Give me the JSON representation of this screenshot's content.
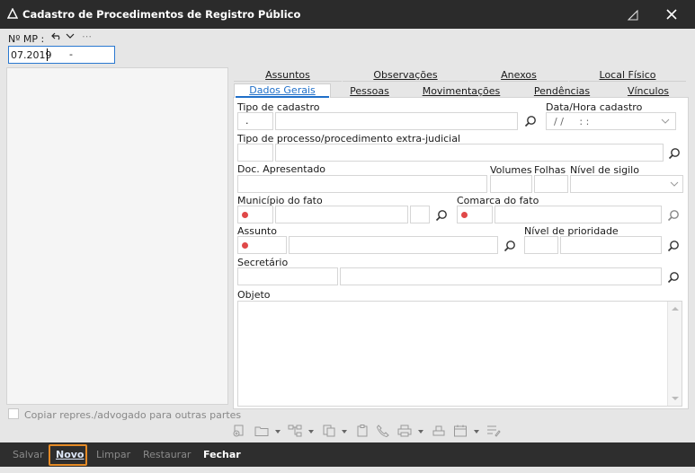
{
  "window": {
    "title": "Cadastro de Procedimentos de Registro Público"
  },
  "mp": {
    "label": "Nº MP :",
    "value": "07.2019",
    "suffix": "-"
  },
  "tabs_top": [
    "Assuntos",
    "Observações",
    "Anexos",
    "Local Físico"
  ],
  "tabs_bottom": [
    "Dados Gerais",
    "Pessoas",
    "Movimentações",
    "Pendências",
    "Vínculos"
  ],
  "form": {
    "tipo_cadastro": {
      "label": "Tipo de cadastro",
      "value": "."
    },
    "data_hora": {
      "label": "Data/Hora cadastro",
      "value": "/ /     : :"
    },
    "tipo_processo": {
      "label": "Tipo de processo/procedimento extra-judicial"
    },
    "doc_apresentado": {
      "label": "Doc. Apresentado"
    },
    "volumes": {
      "label": "Volumes"
    },
    "folhas": {
      "label": "Folhas"
    },
    "nivel_sigilo": {
      "label": "Nível de sigilo"
    },
    "municipio": {
      "label": "Município do fato"
    },
    "comarca": {
      "label": "Comarca do fato"
    },
    "assunto": {
      "label": "Assunto"
    },
    "nivel_prioridade": {
      "label": "Nível de prioridade"
    },
    "secretario": {
      "label": "Secretário"
    },
    "objeto": {
      "label": "Objeto"
    }
  },
  "copiar": {
    "label": "Copiar repres./advogado para outras partes",
    "checked": false
  },
  "bottom_buttons": {
    "salvar": "Salvar",
    "novo": "Novo",
    "limpar": "Limpar",
    "restaurar": "Restaurar",
    "fechar": "Fechar"
  },
  "colors": {
    "titlebar": "#2b2b2b",
    "bottombar": "#2e2e2e",
    "accent": "#e58a25",
    "required_dot": "#e04848",
    "active_tab": "#1f6fc9"
  }
}
